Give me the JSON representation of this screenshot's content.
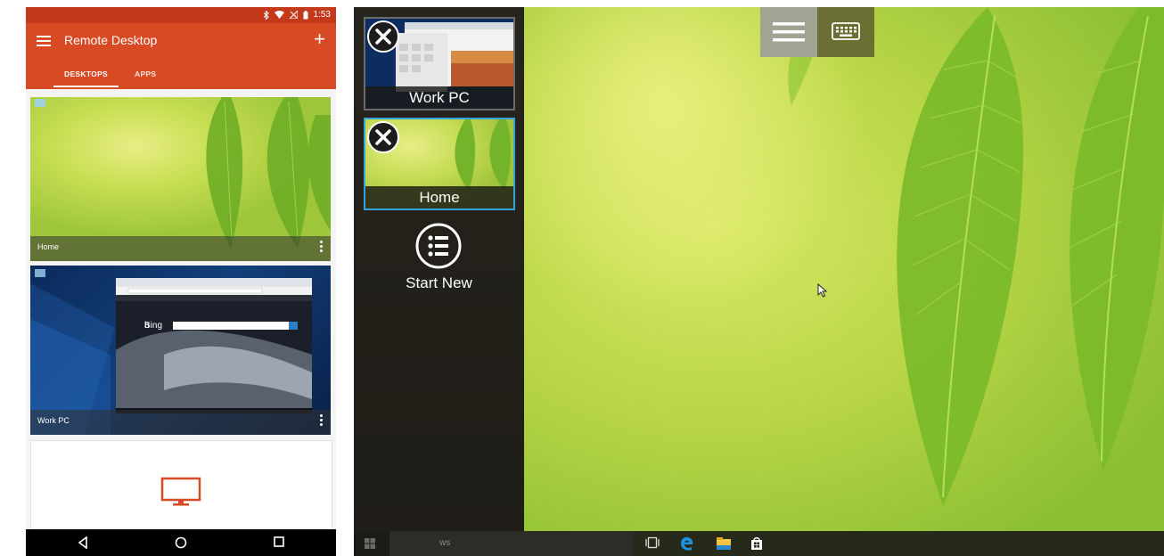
{
  "phone": {
    "status": {
      "time": "1:53"
    },
    "appbar": {
      "title": "Remote Desktop",
      "add_symbol": "+"
    },
    "tabs": [
      {
        "label": "DESKTOPS",
        "selected": true
      },
      {
        "label": "APPS",
        "selected": false
      }
    ],
    "desktops": [
      {
        "name": "Home",
        "thumbnail": "green-leaf-wallpaper"
      },
      {
        "name": "Work PC",
        "thumbnail": "windows-desktop-with-bing-browser"
      }
    ],
    "browser_thumb": {
      "brand": "Bing"
    },
    "add_card": {
      "icon": "monitor-icon"
    }
  },
  "tablet": {
    "sessions": [
      {
        "name": "Work PC",
        "selected": false
      },
      {
        "name": "Home",
        "selected": true
      }
    ],
    "start_new_label": "Start New",
    "taskbar": {
      "search_placeholder": "ws"
    }
  },
  "colors": {
    "accent": "#d84a24",
    "status_bar": "#c4391b",
    "selection_border": "#35a2de",
    "sidebar_bg": "#26241c"
  }
}
